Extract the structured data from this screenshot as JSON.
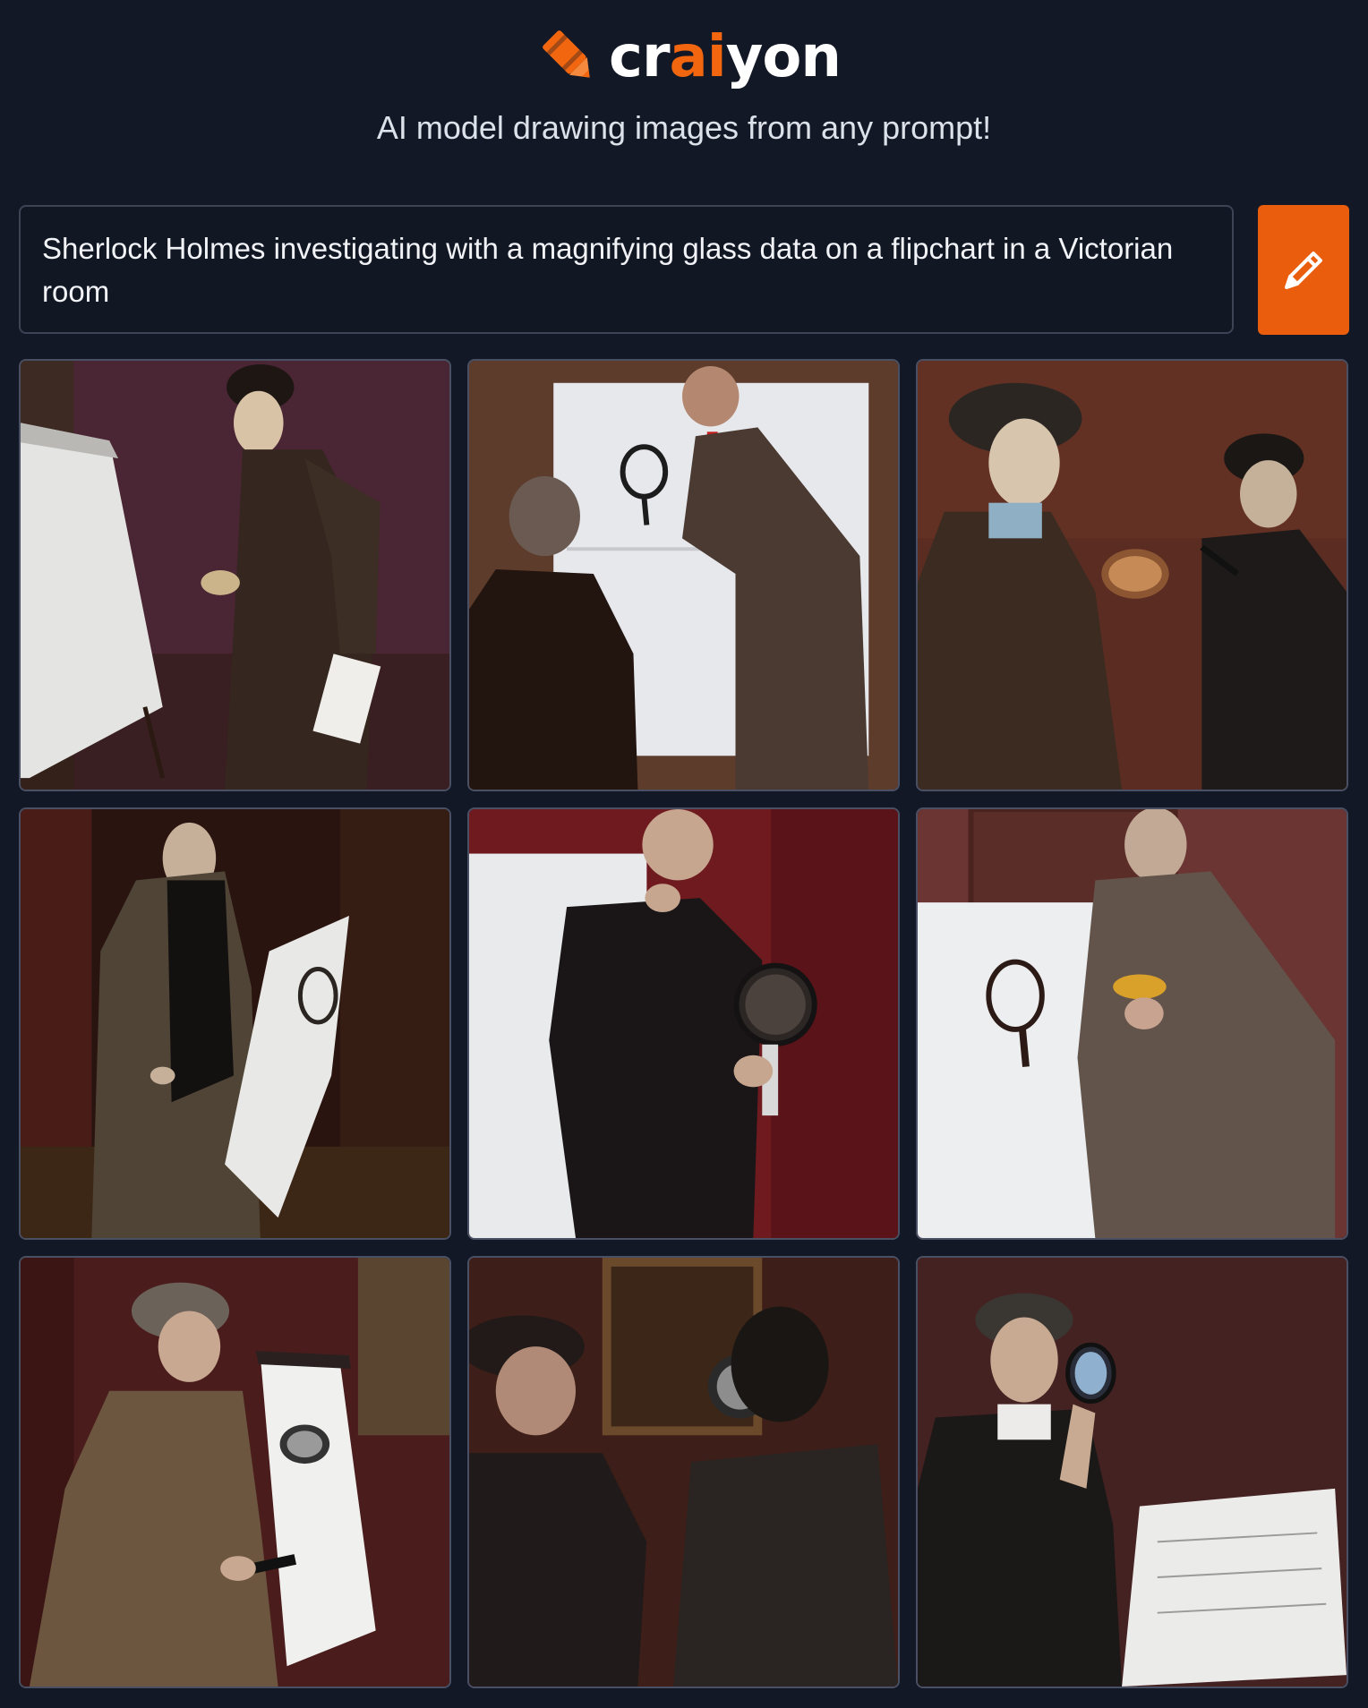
{
  "brand": {
    "name_prefix": "cr",
    "name_accent": "ai",
    "name_suffix": "yon",
    "tagline": "AI model drawing images from any prompt!",
    "accent_color": "#f2660f",
    "logo_icon": "crayon-icon"
  },
  "prompt": {
    "value": "Sherlock Holmes investigating with a magnifying glass data on a flipchart in a Victorian room"
  },
  "draw_button": {
    "icon": "pencil-icon",
    "color": "#ea5d0c"
  },
  "colors": {
    "background": "#131826",
    "tile_border": "#4a5063"
  },
  "results": {
    "count": 9
  }
}
